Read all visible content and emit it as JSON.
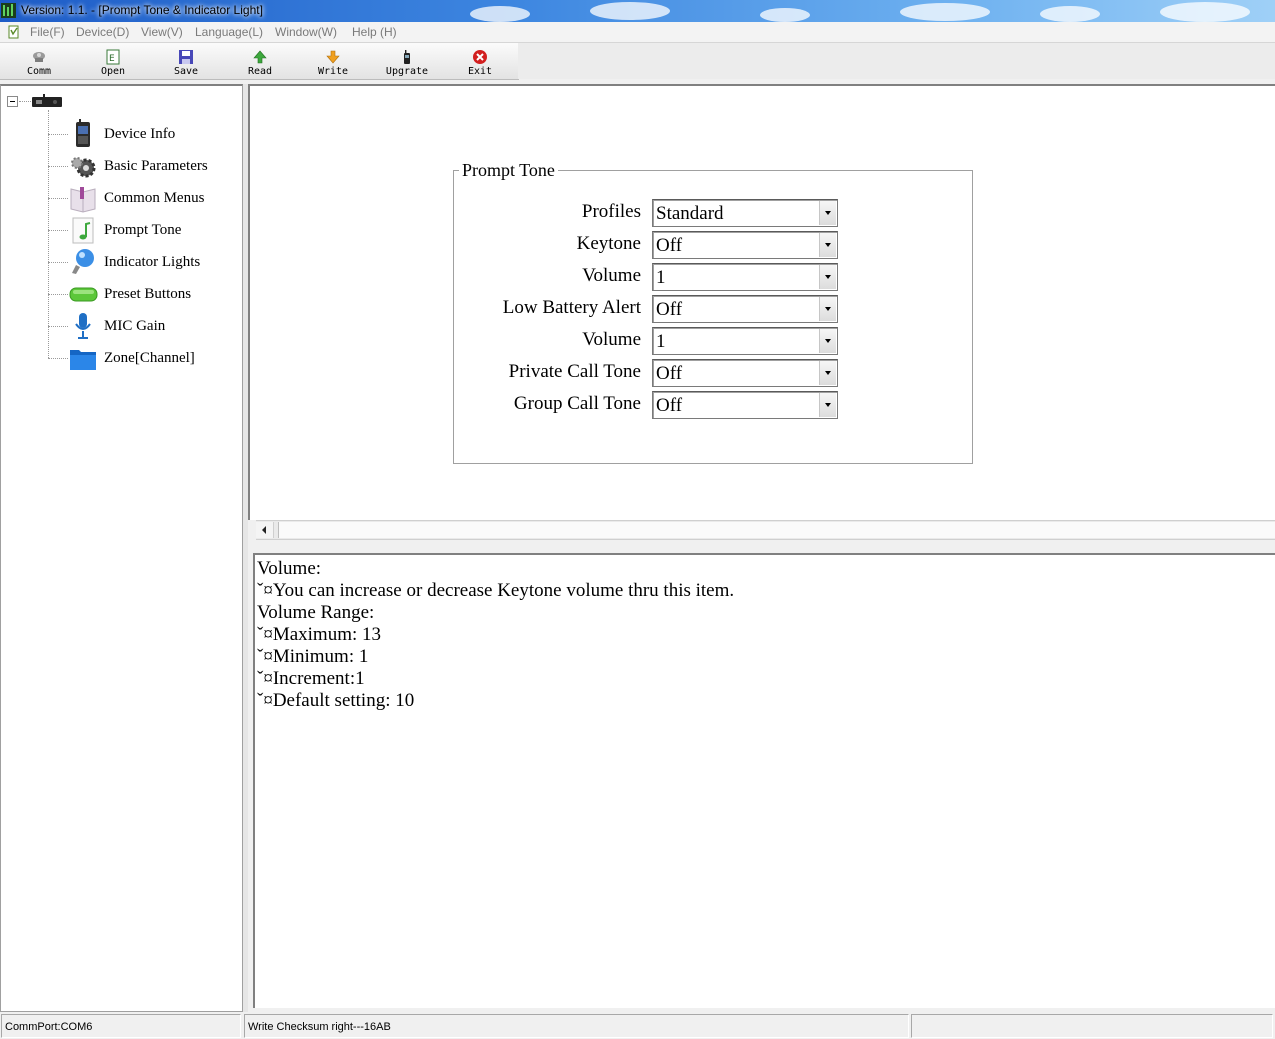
{
  "window": {
    "title": "Version: 1.1. - [Prompt Tone & Indicator Light]"
  },
  "menubar": {
    "items": [
      "File(F)",
      "Device(D)",
      "View(V)",
      "Language(L)",
      "Window(W)",
      "Help (H)"
    ]
  },
  "toolbar": {
    "buttons": [
      {
        "label": "Comm",
        "icon": "comm-icon"
      },
      {
        "label": "Open",
        "icon": "open-icon"
      },
      {
        "label": "Save",
        "icon": "save-icon"
      },
      {
        "label": "Read",
        "icon": "read-arrow-up-icon"
      },
      {
        "label": "Write",
        "icon": "write-arrow-down-icon"
      },
      {
        "label": "Upgrate",
        "icon": "upgrade-radio-icon"
      },
      {
        "label": "Exit",
        "icon": "exit-icon"
      }
    ]
  },
  "tree": {
    "root_icon": "device-radio-icon",
    "items": [
      {
        "label": "Device Info",
        "icon": "device-info-icon"
      },
      {
        "label": "Basic Parameters",
        "icon": "gear-icon"
      },
      {
        "label": "Common Menus",
        "icon": "book-icon"
      },
      {
        "label": "Prompt Tone",
        "icon": "music-note-icon"
      },
      {
        "label": "Indicator Lights",
        "icon": "light-bulb-icon"
      },
      {
        "label": "Preset Buttons",
        "icon": "button-icon"
      },
      {
        "label": "MIC Gain",
        "icon": "microphone-icon"
      },
      {
        "label": "Zone[Channel]",
        "icon": "folder-icon"
      }
    ]
  },
  "prompt_tone": {
    "title": "Prompt Tone",
    "fields": [
      {
        "label": "Profiles",
        "value": "Standard"
      },
      {
        "label": "Keytone",
        "value": "Off"
      },
      {
        "label": "Volume",
        "value": "1"
      },
      {
        "label": "Low Battery Alert",
        "value": "Off"
      },
      {
        "label": "Volume",
        "value": "1"
      },
      {
        "label": "Private Call Tone",
        "value": "Off"
      },
      {
        "label": "Group Call Tone",
        "value": "Off"
      }
    ]
  },
  "help": {
    "lines": [
      "Volume:",
      "ˇ¤You can increase or decrease Keytone volume thru this item.",
      "Volume Range:",
      "ˇ¤Maximum:  13",
      "ˇ¤Minimum:  1",
      "ˇ¤Increment:1",
      "ˇ¤Default setting: 10"
    ]
  },
  "statusbar": {
    "port": "CommPort:COM6",
    "message": "Write Checksum right---16AB",
    "extra": ""
  }
}
